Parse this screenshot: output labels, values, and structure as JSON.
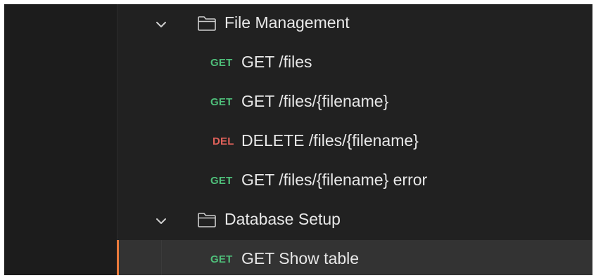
{
  "colors": {
    "background": "#212121",
    "get_method": "#4fbf7a",
    "delete_method": "#e0615a",
    "selected_accent": "#ea7a3c",
    "selected_row": "#333333"
  },
  "tree": {
    "file_management": {
      "label": "File Management",
      "icon": "folder-icon",
      "expanded": true,
      "requests": [
        {
          "method": "GET",
          "label": "GET /files"
        },
        {
          "method": "GET",
          "label": "GET /files/{filename}"
        },
        {
          "method": "DEL",
          "label": "DELETE /files/{filename}"
        },
        {
          "method": "GET",
          "label": "GET /files/{filename} error"
        }
      ]
    },
    "database_setup": {
      "label": "Database Setup",
      "icon": "folder-icon",
      "expanded": true,
      "requests": [
        {
          "method": "GET",
          "label": "GET Show table",
          "selected": true
        }
      ]
    }
  }
}
